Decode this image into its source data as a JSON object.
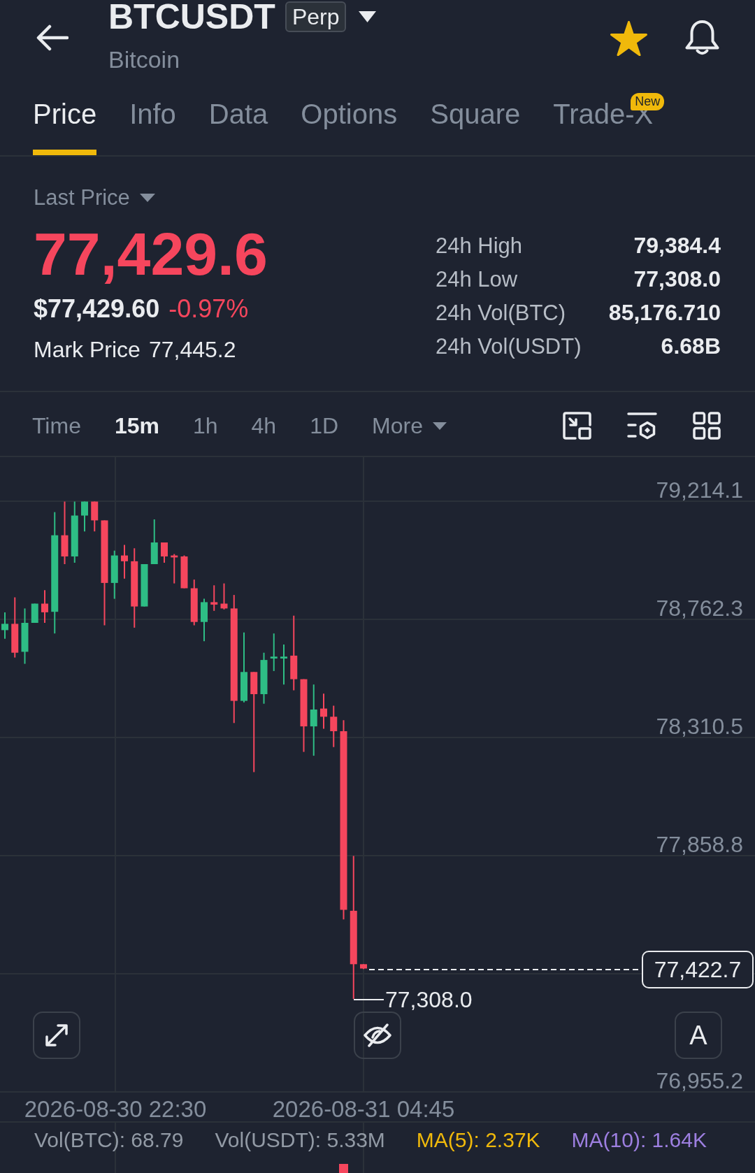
{
  "header": {
    "title": "BTCUSDT",
    "badge": "Perp",
    "subtitle": "Bitcoin",
    "favorite": true
  },
  "tabs": [
    {
      "label": "Price",
      "selected": true
    },
    {
      "label": "Info",
      "selected": false
    },
    {
      "label": "Data",
      "selected": false
    },
    {
      "label": "Options",
      "selected": false
    },
    {
      "label": "Square",
      "selected": false
    },
    {
      "label": "Trade-X",
      "selected": false,
      "badge": "New"
    }
  ],
  "price": {
    "selector": "Last Price",
    "value": "77,429.6",
    "usd_value": "$77,429.60",
    "change": "-0.97%",
    "falling": true,
    "mark_label": "Mark Price",
    "mark_value": "77,445.2"
  },
  "stats": [
    {
      "label": "24h High",
      "value": "79,384.4"
    },
    {
      "label": "24h Low",
      "value": "77,308.0"
    },
    {
      "label": "24h Vol(BTC)",
      "value": "85,176.710"
    },
    {
      "label": "24h Vol(USDT)",
      "value": "6.68B"
    }
  ],
  "intervals": [
    {
      "label": "Time",
      "selected": false
    },
    {
      "label": "15m",
      "selected": true
    },
    {
      "label": "1h",
      "selected": false
    },
    {
      "label": "4h",
      "selected": false
    },
    {
      "label": "1D",
      "selected": false
    }
  ],
  "more": {
    "label": "More"
  },
  "chart": {
    "price_axis": [
      "79,214.1",
      "78,762.3",
      "78,310.5",
      "77,858.8",
      "76,955.2"
    ],
    "current_price": "77,422.7",
    "low_price": "77,308.0",
    "auto_button": "A",
    "time_axis": [
      "2026-08-30 22:30",
      "2026-08-31 04:45"
    ]
  },
  "indicators": [
    {
      "label": "Vol(BTC): 68.79",
      "color": "#929aa5"
    },
    {
      "label": "Vol(USDT): 5.33M",
      "color": "#929aa5"
    },
    {
      "label": "MA(5): 2.37K",
      "color": "#f0b90b"
    },
    {
      "label": "MA(10): 1.64K",
      "color": "#9d7fe0"
    }
  ]
}
